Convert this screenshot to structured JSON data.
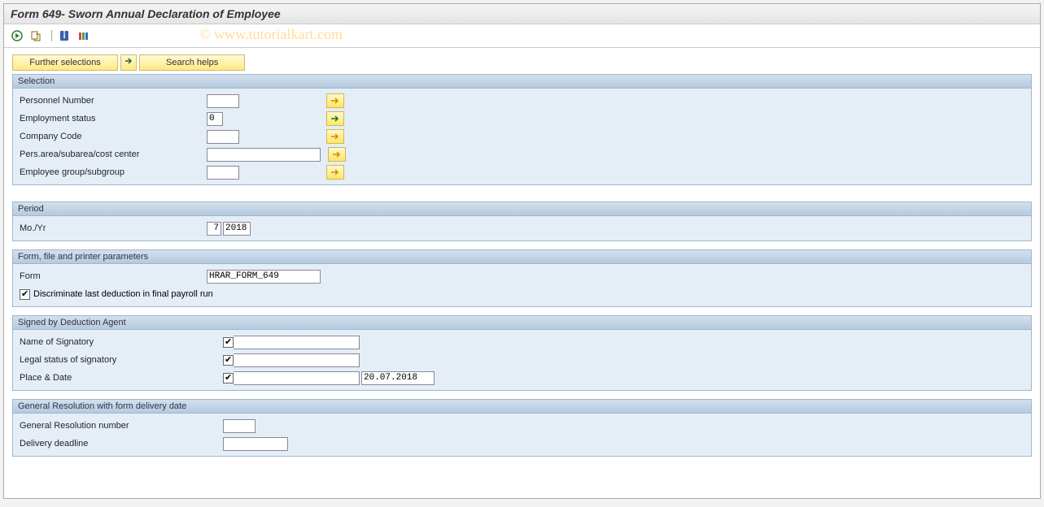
{
  "header": {
    "title": "Form 649- Sworn Annual Declaration of Employee"
  },
  "watermark": "© www.tutorialkart.com",
  "top_buttons": {
    "further_selections": "Further selections",
    "search_helps": "Search helps"
  },
  "groups": {
    "selection": {
      "title": "Selection",
      "personnel_number_label": "Personnel Number",
      "personnel_number_value": "",
      "employment_status_label": "Employment status",
      "employment_status_value": "0",
      "company_code_label": "Company Code",
      "company_code_value": "",
      "pers_area_label": "Pers.area/subarea/cost center",
      "pers_area_value": "",
      "emp_group_label": "Employee group/subgroup",
      "emp_group_value": ""
    },
    "period": {
      "title": "Period",
      "moyear_label": "Mo./Yr",
      "month_value": "7",
      "year_value": "2018"
    },
    "formparams": {
      "title": "Form, file and printer parameters",
      "form_label": "Form",
      "form_value": "HRAR_FORM_649",
      "discriminate_label": "Discriminate last deduction in final payroll run",
      "discriminate_checked": true
    },
    "signed": {
      "title": "Signed by Deduction Agent",
      "name_label": "Name of Signatory",
      "name_value": "",
      "legal_label": "Legal status of signatory",
      "legal_value": "",
      "placedate_label": "Place & Date",
      "place_value": "",
      "date_value": "20.07.2018"
    },
    "general": {
      "title": "General Resolution with form delivery date",
      "resolution_label": "General Resolution number",
      "resolution_value": "",
      "deadline_label": "Delivery deadline",
      "deadline_value": ""
    }
  }
}
